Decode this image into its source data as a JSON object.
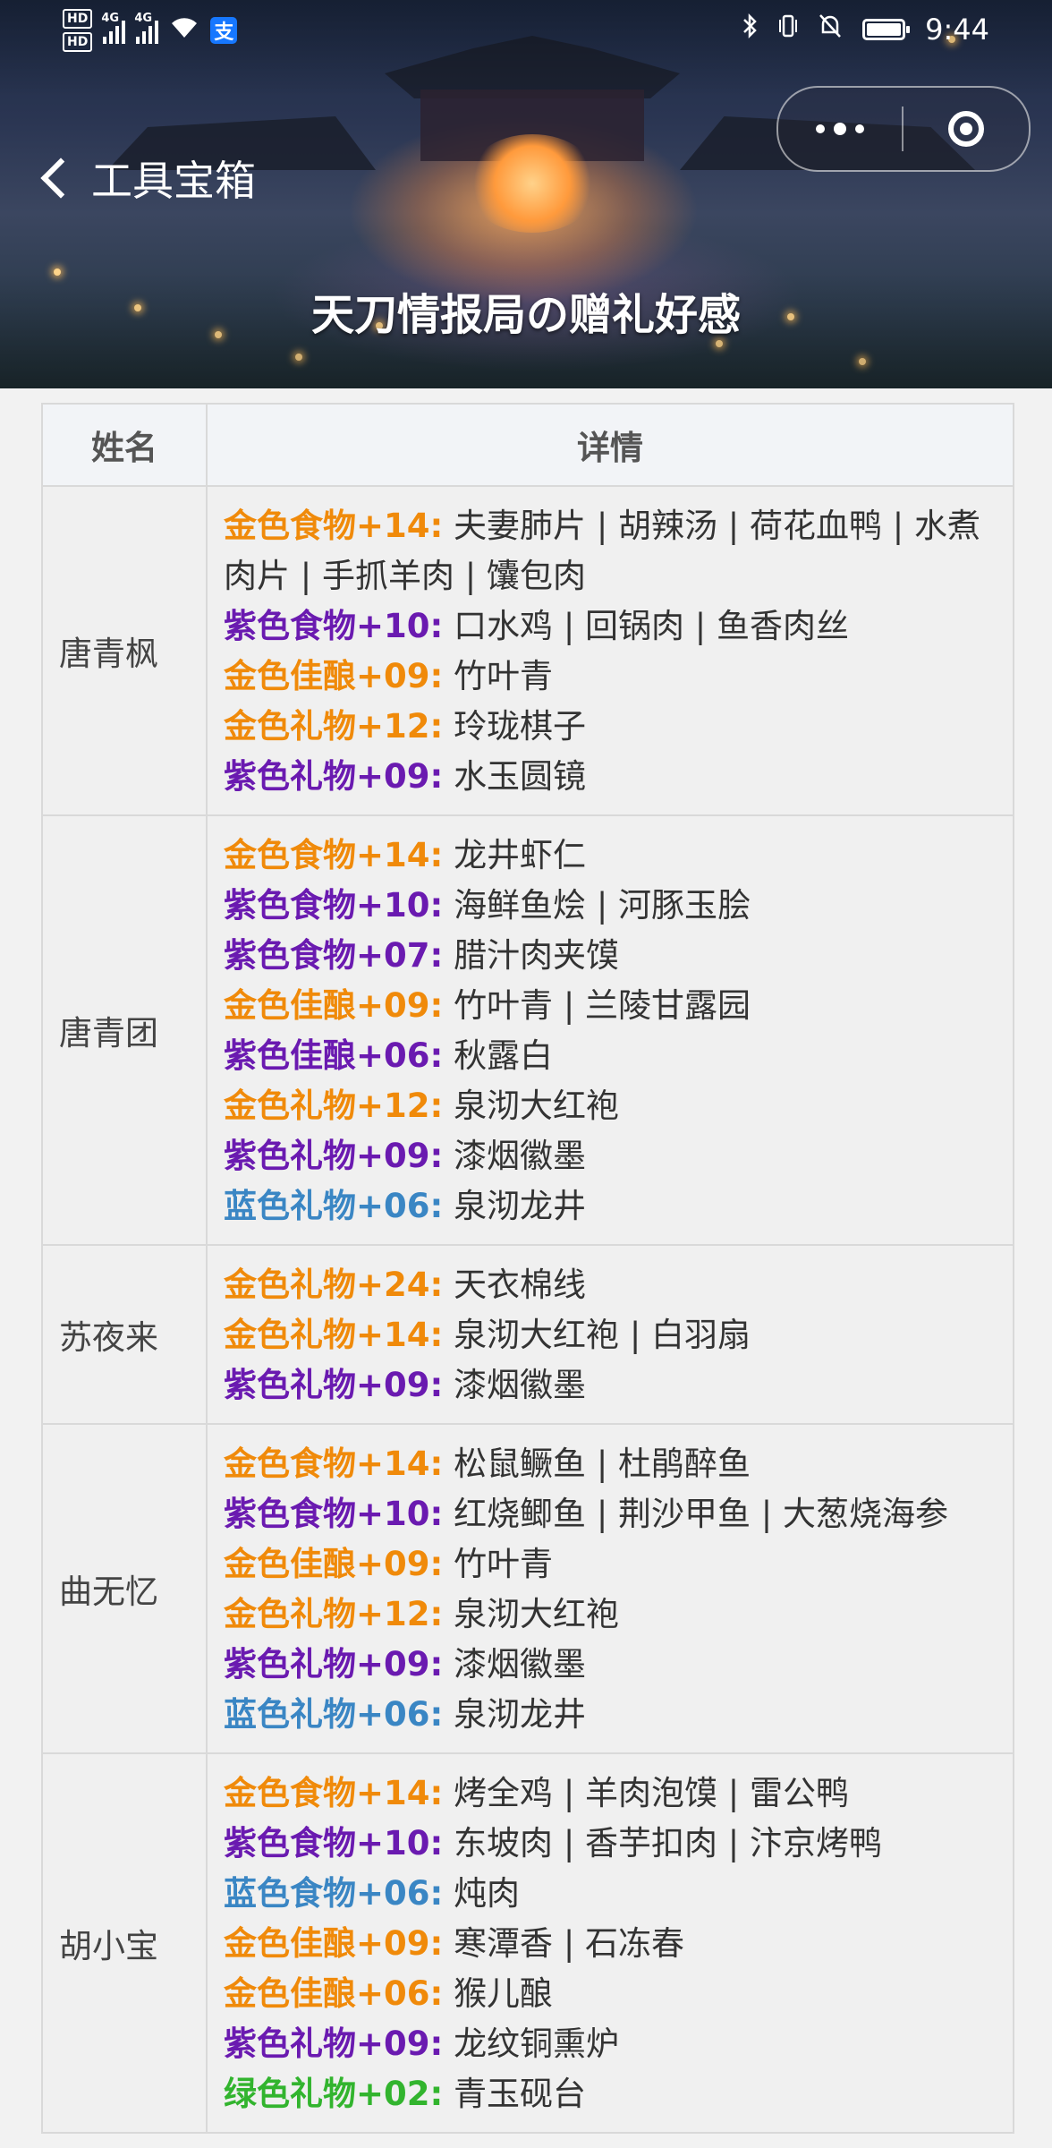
{
  "status_bar": {
    "hd_top": "HD",
    "hd_bottom": "HD",
    "net1": "4G",
    "net2": "4G",
    "pay_icon_char": "支",
    "time": "9:44"
  },
  "nav": {
    "back_label": "工具宝箱",
    "page_title": "天刀情报局の赠礼好感"
  },
  "table": {
    "headers": [
      "姓名",
      "详情"
    ],
    "rows": [
      {
        "name": "唐青枫",
        "lines": [
          {
            "key": "金色食物+14:",
            "color": "gold",
            "value": "夫妻肺片 | 胡辣汤 | 荷花血鸭 | 水煮肉片 | 手抓羊肉 | 馕包肉"
          },
          {
            "key": "紫色食物+10:",
            "color": "purple",
            "value": "口水鸡 | 回锅肉 | 鱼香肉丝"
          },
          {
            "key": "金色佳酿+09:",
            "color": "gold",
            "value": "竹叶青"
          },
          {
            "key": "金色礼物+12:",
            "color": "gold",
            "value": "玲珑棋子"
          },
          {
            "key": "紫色礼物+09:",
            "color": "purple",
            "value": "水玉圆镜"
          }
        ]
      },
      {
        "name": "唐青团",
        "lines": [
          {
            "key": "金色食物+14:",
            "color": "gold",
            "value": "龙井虾仁"
          },
          {
            "key": "紫色食物+10:",
            "color": "purple",
            "value": "海鲜鱼烩 | 河豚玉脍"
          },
          {
            "key": "紫色食物+07:",
            "color": "purple",
            "value": "腊汁肉夹馍"
          },
          {
            "key": "金色佳酿+09:",
            "color": "gold",
            "value": "竹叶青 | 兰陵甘露园"
          },
          {
            "key": "紫色佳酿+06:",
            "color": "purple",
            "value": "秋露白"
          },
          {
            "key": "金色礼物+12:",
            "color": "gold",
            "value": "泉沏大红袍"
          },
          {
            "key": "紫色礼物+09:",
            "color": "purple",
            "value": "漆烟徽墨"
          },
          {
            "key": "蓝色礼物+06:",
            "color": "blue",
            "value": "泉沏龙井"
          }
        ]
      },
      {
        "name": "苏夜来",
        "lines": [
          {
            "key": "金色礼物+24:",
            "color": "gold",
            "value": "天衣棉线"
          },
          {
            "key": "金色礼物+14:",
            "color": "gold",
            "value": "泉沏大红袍 | 白羽扇"
          },
          {
            "key": "紫色礼物+09:",
            "color": "purple",
            "value": "漆烟徽墨"
          }
        ]
      },
      {
        "name": "曲无忆",
        "lines": [
          {
            "key": "金色食物+14:",
            "color": "gold",
            "value": "松鼠鳜鱼 | 杜鹃醉鱼"
          },
          {
            "key": "紫色食物+10:",
            "color": "purple",
            "value": "红烧鲫鱼 | 荆沙甲鱼 | 大葱烧海参"
          },
          {
            "key": "金色佳酿+09:",
            "color": "gold",
            "value": "竹叶青"
          },
          {
            "key": "金色礼物+12:",
            "color": "gold",
            "value": "泉沏大红袍"
          },
          {
            "key": "紫色礼物+09:",
            "color": "purple",
            "value": "漆烟徽墨"
          },
          {
            "key": "蓝色礼物+06:",
            "color": "blue",
            "value": "泉沏龙井"
          }
        ]
      },
      {
        "name": "胡小宝",
        "lines": [
          {
            "key": "金色食物+14:",
            "color": "gold",
            "value": "烤全鸡 | 羊肉泡馍 | 雷公鸭"
          },
          {
            "key": "紫色食物+10:",
            "color": "purple",
            "value": "东坡肉 | 香芋扣肉 | 汴京烤鸭"
          },
          {
            "key": "蓝色食物+06:",
            "color": "blue",
            "value": "炖肉"
          },
          {
            "key": "金色佳酿+09:",
            "color": "gold",
            "value": "寒潭香 | 石冻春"
          },
          {
            "key": "金色佳酿+06:",
            "color": "gold",
            "value": "猴儿酿"
          },
          {
            "key": "紫色礼物+09:",
            "color": "purple",
            "value": "龙纹铜熏炉"
          },
          {
            "key": "绿色礼物+02:",
            "color": "green",
            "value": "青玉砚台"
          }
        ]
      }
    ]
  }
}
